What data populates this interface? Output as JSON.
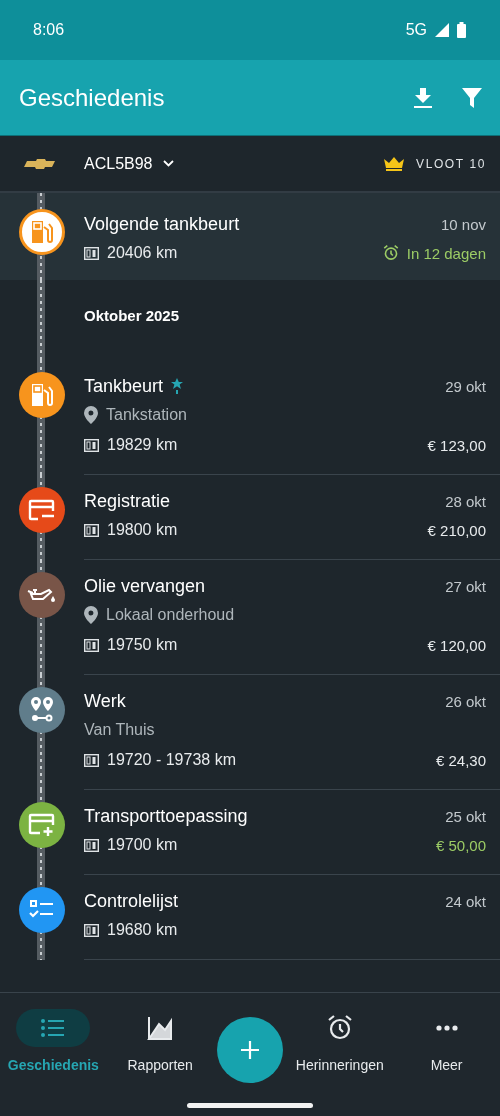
{
  "status_bar": {
    "time": "8:06",
    "network": "5G"
  },
  "app_bar": {
    "title": "Geschiedenis"
  },
  "vehicle": {
    "plate": "ACL5B98",
    "plan": "VLOOT 10"
  },
  "upcoming": {
    "title": "Volgende tankbeurt",
    "date": "10 nov",
    "odometer": "20406 km",
    "reminder": "In 12 dagen",
    "color": "#f7941d"
  },
  "section": "Oktober 2025",
  "entries": [
    {
      "kind": "fuel",
      "color": "#f7941d",
      "title": "Tankbeurt",
      "starred": true,
      "date": "29 okt",
      "location": "Tankstation",
      "odometer": "19829 km",
      "price": "€ 123,00",
      "income": false
    },
    {
      "kind": "registration",
      "color": "#e64a19",
      "title": "Registratie",
      "starred": false,
      "date": "28 okt",
      "odometer": "19800 km",
      "price": "€ 210,00",
      "income": false
    },
    {
      "kind": "oil",
      "color": "#795548",
      "title": "Olie vervangen",
      "starred": false,
      "date": "27 okt",
      "location": "Lokaal onderhoud",
      "odometer": "19750 km",
      "price": "€ 120,00",
      "income": false
    },
    {
      "kind": "trip",
      "color": "#607d8b",
      "title": "Werk",
      "starred": false,
      "date": "26 okt",
      "subtitle": "Van Thuis",
      "odometer": "19720 - 19738 km",
      "price": "€ 24,30",
      "income": false
    },
    {
      "kind": "income",
      "color": "#7cb342",
      "title": "Transporttoepassing",
      "starred": false,
      "date": "25 okt",
      "odometer": "19700 km",
      "price": "€ 50,00",
      "income": true
    },
    {
      "kind": "checklist",
      "color": "#2196f3",
      "title": "Controlelijst",
      "starred": false,
      "date": "24 okt",
      "odometer": "19680 km"
    }
  ],
  "nav": [
    {
      "kind": "history",
      "label": "Geschiedenis",
      "selected": true
    },
    {
      "kind": "reports",
      "label": "Rapporten",
      "selected": false
    },
    {
      "kind": "add"
    },
    {
      "kind": "reminders",
      "label": "Herinneringen",
      "selected": false
    },
    {
      "kind": "more",
      "label": "Meer",
      "selected": false
    }
  ]
}
